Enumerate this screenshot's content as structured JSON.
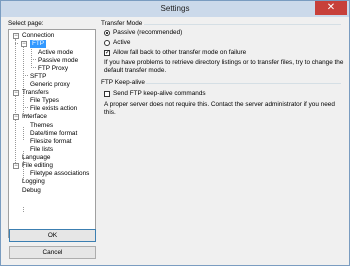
{
  "window": {
    "title": "Settings",
    "close_glyph": "✕"
  },
  "sidebar": {
    "label": "Select page:",
    "tree": [
      {
        "label": "Connection",
        "expander": "−"
      },
      {
        "label": "FTP",
        "expander": "−",
        "selected": true
      },
      {
        "label": "Active mode"
      },
      {
        "label": "Passive mode"
      },
      {
        "label": "FTP Proxy"
      },
      {
        "label": "SFTP"
      },
      {
        "label": "Generic proxy"
      },
      {
        "label": "Transfers",
        "expander": "−"
      },
      {
        "label": "File Types"
      },
      {
        "label": "File exists action"
      },
      {
        "label": "Interface",
        "expander": "−"
      },
      {
        "label": "Themes"
      },
      {
        "label": "Date/time format"
      },
      {
        "label": "Filesize format"
      },
      {
        "label": "File lists"
      },
      {
        "label": "Language"
      },
      {
        "label": "File editing",
        "expander": "−"
      },
      {
        "label": "Filetype associations"
      },
      {
        "label": "Logging"
      },
      {
        "label": "Debug"
      }
    ]
  },
  "buttons": {
    "ok": "OK",
    "cancel": "Cancel"
  },
  "transfer_mode": {
    "heading": "Transfer Mode",
    "passive": "Passive (recommended)",
    "active": "Active",
    "fallback": "Allow fall back to other transfer mode on failure",
    "fallback_check": "✓",
    "note": "If you have problems to retrieve directory listings or to transfer files, try to change the default transfer mode."
  },
  "keepalive": {
    "heading": "FTP Keep-alive",
    "option": "Send FTP keep-alive commands",
    "note": "A proper server does not require this. Contact the server administrator if you need this."
  }
}
